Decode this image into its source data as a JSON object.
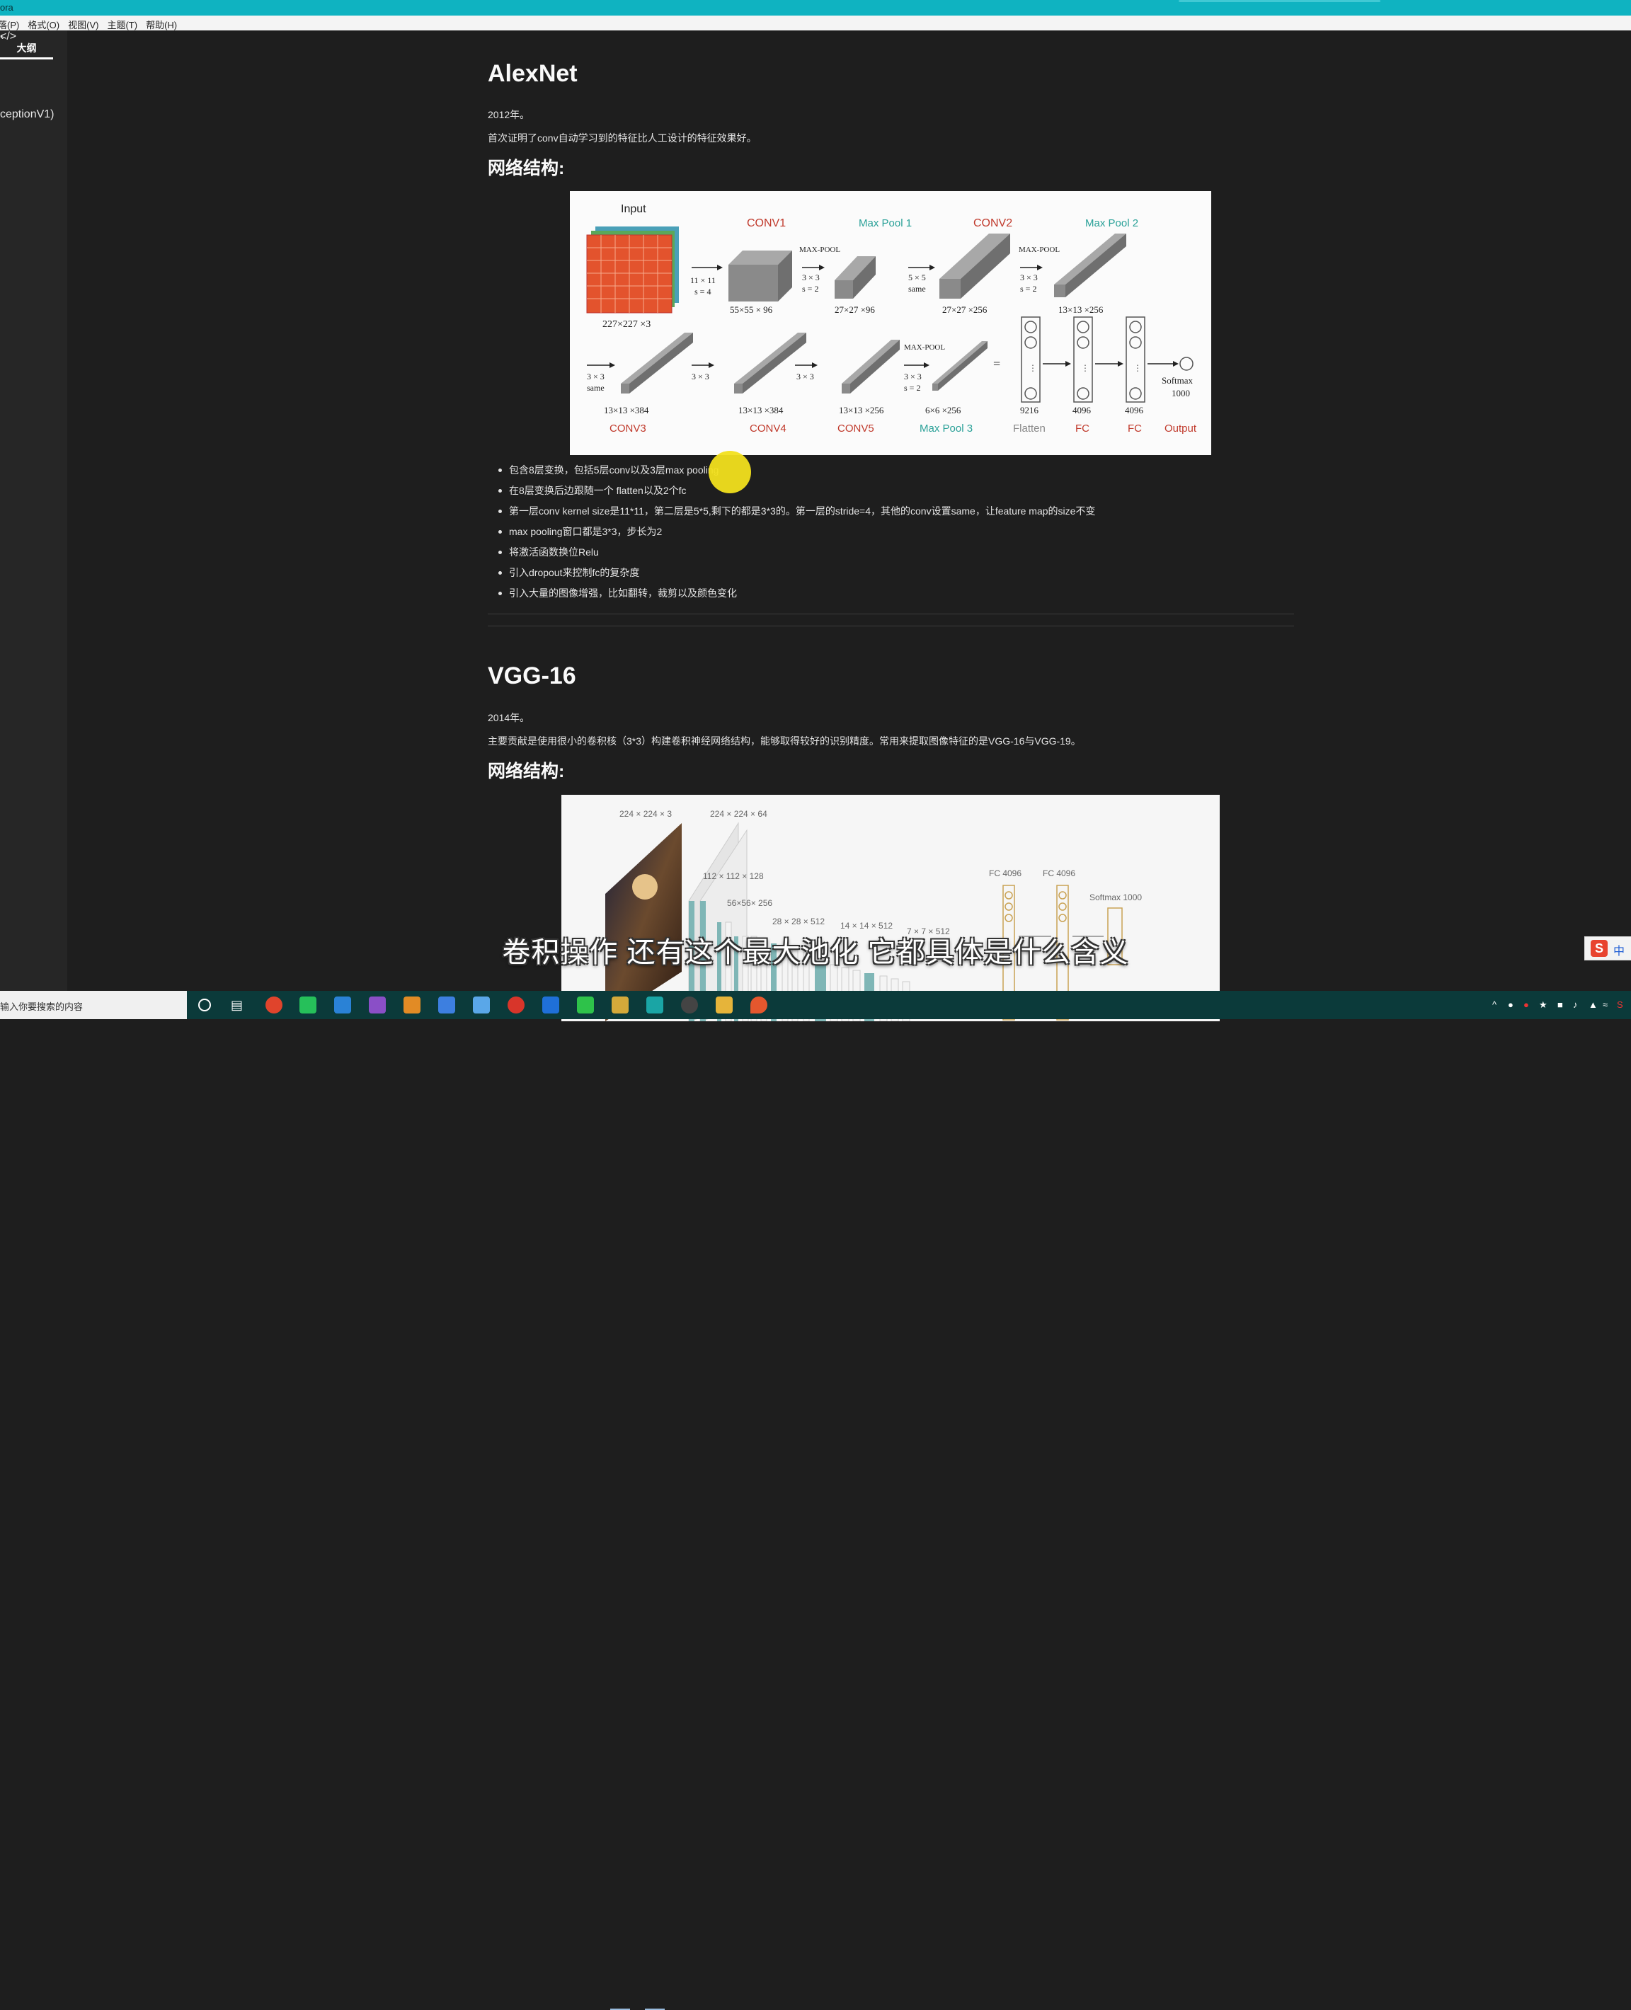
{
  "window": {
    "app_title": "ora"
  },
  "menu": [
    "落(P)",
    "格式(O)",
    "视图(V)",
    "主题(T)",
    "帮助(H)"
  ],
  "sidebar": {
    "tab_label": "大纲",
    "outline_item": "ceptionV1)"
  },
  "doc": {
    "alexnet": {
      "title": "AlexNet",
      "year": "2012年。",
      "intro": "首次证明了conv自动学习到的特征比人工设计的特征效果好。",
      "arch_heading": "网络结构:",
      "bullets": [
        "包含8层变换，包括5层conv以及3层max pooling",
        "在8层变换后边跟随一个 flatten以及2个fc",
        "第一层conv kernel size是11*11，第二层是5*5,剩下的都是3*3的。第一层的stride=4，其他的conv设置same，让feature map的size不变",
        "max pooling窗口都是3*3，步长为2",
        "将激活函数换位Relu",
        "引入dropout来控制fc的复杂度",
        "引入大量的图像增强，比如翻转，裁剪以及颜色变化"
      ],
      "figure": {
        "input": "Input",
        "input_dim": "227×227 ×3",
        "conv1": "CONV1",
        "conv1_op1": "11 × 11",
        "conv1_op2": "s = 4",
        "conv1_dim": "55×55 × 96",
        "mp1": "Max Pool 1",
        "mp_op": "MAX-POOL",
        "mp1_op1": "3 × 3",
        "mp1_op2": "s = 2",
        "mp1_dim": "27×27 ×96",
        "conv2": "CONV2",
        "conv2_op1": "5 × 5",
        "conv2_op2": "same",
        "conv2_dim": "27×27 ×256",
        "mp2": "Max Pool 2",
        "mp2_op1": "3 × 3",
        "mp2_op2": "s = 2",
        "mp2_dim": "13×13 ×256",
        "conv3": "CONV3",
        "conv3_op1": "3 × 3",
        "conv3_op2": "same",
        "conv3_dim": "13×13 ×384",
        "conv4": "CONV4",
        "conv4_op": "3 × 3",
        "conv4_dim": "13×13 ×384",
        "conv5": "CONV5",
        "conv5_op": "3 × 3",
        "conv5_dim": "13×13 ×256",
        "mp3": "Max Pool 3",
        "mp3_op1": "3 × 3",
        "mp3_op2": "s = 2",
        "mp3_dim": "6×6 ×256",
        "equals": "=",
        "flatten": "Flatten",
        "flatten_dim": "9216",
        "fc1": "FC",
        "fc1_dim": "4096",
        "fc2": "FC",
        "fc2_dim": "4096",
        "softmax": "Softmax",
        "softmax_dim": "1000",
        "output": "Output",
        "colors": {
          "conv": "#c0392b",
          "pool": "#2aa198",
          "layer": "#8a8a8a"
        }
      }
    },
    "vgg16": {
      "title": "VGG-16",
      "year": "2014年。",
      "intro": "主要贡献是使用很小的卷积核（3*3）构建卷积神经网络结构，能够取得较好的识别精度。常用来提取图像特征的是VGG-16与VGG-19。",
      "arch_heading": "网络结构:",
      "figure": {
        "l1": "224 × 224 × 3",
        "l2": "224 × 224 × 64",
        "l3": "112 × 112 × 128",
        "l4": "56×56× 256",
        "l5": "28 × 28 × 512",
        "l6": "14 × 14 × 512",
        "l7": "7 × 7 × 512",
        "fc1": "FC 4096",
        "fc2": "FC 4096",
        "softmax": "Softmax 1000"
      }
    }
  },
  "overlay": {
    "subtitle": "卷积操作 还有这个最大池化 它都具体是什么含义",
    "ime_label": "中"
  },
  "taskbar": {
    "search_placeholder": "输入你要搜索的内容"
  }
}
